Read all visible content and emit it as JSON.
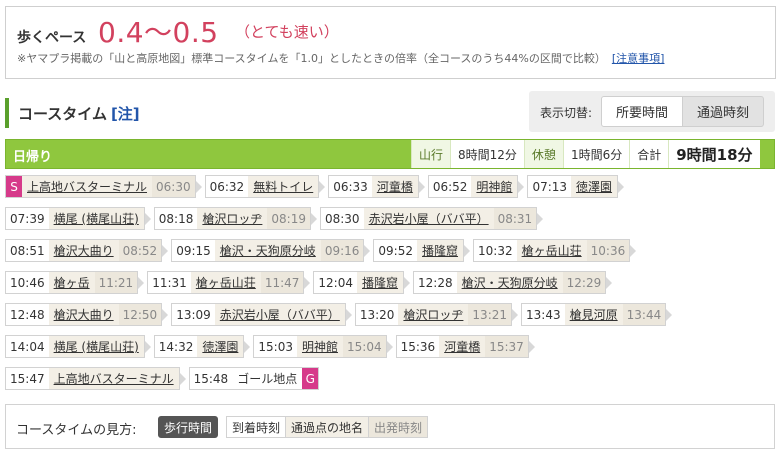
{
  "pace": {
    "label": "歩くペース",
    "value": "0.4〜0.5",
    "note": "（とても速い）",
    "description": "※ヤマプラ掲載の「山と高原地図」標準コースタイムを「1.0」としたときの倍率（全コースのうち44%の区間で比較）",
    "caution_link": "[注意事項]"
  },
  "coursetime": {
    "title": "コースタイム",
    "note_link": "[注]",
    "switch_label": "表示切替:",
    "switch_a": "所要時間",
    "switch_b": "通過時刻"
  },
  "day": {
    "title": "日帰り",
    "yama_label": "山行",
    "yama_value": "8時間12分",
    "rest_label": "休憩",
    "rest_value": "1時間6分",
    "total_label": "合計",
    "total_value": "9時間18分"
  },
  "route": {
    "start_badge": "S",
    "goal_badge": "G",
    "goal_label": "ゴール地点",
    "rows": [
      [
        {
          "arr": "",
          "place": "上高地バスターミナル",
          "dep": "06:30",
          "start": true
        },
        {
          "arr": "06:32",
          "place": "無料トイレ",
          "dep": ""
        },
        {
          "arr": "06:33",
          "place": "河童橋",
          "dep": ""
        },
        {
          "arr": "06:52",
          "place": "明神館",
          "dep": ""
        },
        {
          "arr": "07:13",
          "place": "徳澤園",
          "dep": ""
        }
      ],
      [
        {
          "arr": "07:39",
          "place": "横尾 (横尾山荘)",
          "dep": ""
        },
        {
          "arr": "08:18",
          "place": "槍沢ロッヂ",
          "dep": "08:19"
        },
        {
          "arr": "08:30",
          "place": "赤沢岩小屋（ババ平）",
          "dep": "08:31"
        }
      ],
      [
        {
          "arr": "08:51",
          "place": "槍沢大曲り",
          "dep": "08:52"
        },
        {
          "arr": "09:15",
          "place": "槍沢・天狗原分岐",
          "dep": "09:16"
        },
        {
          "arr": "09:52",
          "place": "播隆窟",
          "dep": ""
        },
        {
          "arr": "10:32",
          "place": "槍ヶ岳山荘",
          "dep": "10:36"
        }
      ],
      [
        {
          "arr": "10:46",
          "place": "槍ヶ岳",
          "dep": "11:21"
        },
        {
          "arr": "11:31",
          "place": "槍ヶ岳山荘",
          "dep": "11:47"
        },
        {
          "arr": "12:04",
          "place": "播隆窟",
          "dep": ""
        },
        {
          "arr": "12:28",
          "place": "槍沢・天狗原分岐",
          "dep": "12:29"
        }
      ],
      [
        {
          "arr": "12:48",
          "place": "槍沢大曲り",
          "dep": "12:50"
        },
        {
          "arr": "13:09",
          "place": "赤沢岩小屋（ババ平）",
          "dep": ""
        },
        {
          "arr": "13:20",
          "place": "槍沢ロッヂ",
          "dep": "13:21"
        },
        {
          "arr": "13:43",
          "place": "槍見河原",
          "dep": "13:44"
        }
      ],
      [
        {
          "arr": "14:04",
          "place": "横尾 (横尾山荘)",
          "dep": ""
        },
        {
          "arr": "14:32",
          "place": "徳澤園",
          "dep": ""
        },
        {
          "arr": "15:03",
          "place": "明神館",
          "dep": "15:04"
        },
        {
          "arr": "15:36",
          "place": "河童橋",
          "dep": "15:37"
        }
      ],
      [
        {
          "arr": "15:47",
          "place": "上高地バスターミナル",
          "dep": ""
        },
        {
          "arr": "15:48",
          "place": "",
          "dep": "",
          "goal": true
        }
      ]
    ]
  },
  "legend": {
    "label": "コースタイムの見方:",
    "walk": "歩行時間",
    "arrival": "到着時刻",
    "place": "通過点の地名",
    "departure": "出発時刻"
  },
  "colors": {
    "accent": "#8fc73e",
    "pace": "#d2415e",
    "badge": "#d63a8a"
  }
}
